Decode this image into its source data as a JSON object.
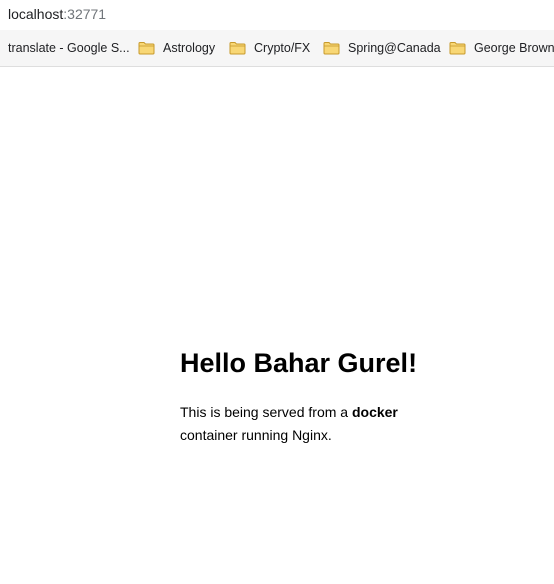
{
  "browser": {
    "address": {
      "host": "localhost",
      "port": ":32771"
    },
    "bookmarks": [
      {
        "label": "translate - Google S...",
        "icon": ""
      },
      {
        "label": "Astrology",
        "icon": "folder-icon"
      },
      {
        "label": "Crypto/FX",
        "icon": "folder-icon"
      },
      {
        "label": "Spring@Canada",
        "icon": "folder-icon"
      },
      {
        "label": "George Brown",
        "icon": "folder-icon"
      }
    ]
  },
  "page": {
    "heading": "Hello Bahar Gurel!",
    "para_pre": "This is being served from a ",
    "para_bold": "docker",
    "para_post": " container running Nginx."
  },
  "colors": {
    "folder_fill": "#f8d775",
    "folder_stroke": "#c79a2c",
    "bookmarks_bg": "#f6f6f6"
  }
}
